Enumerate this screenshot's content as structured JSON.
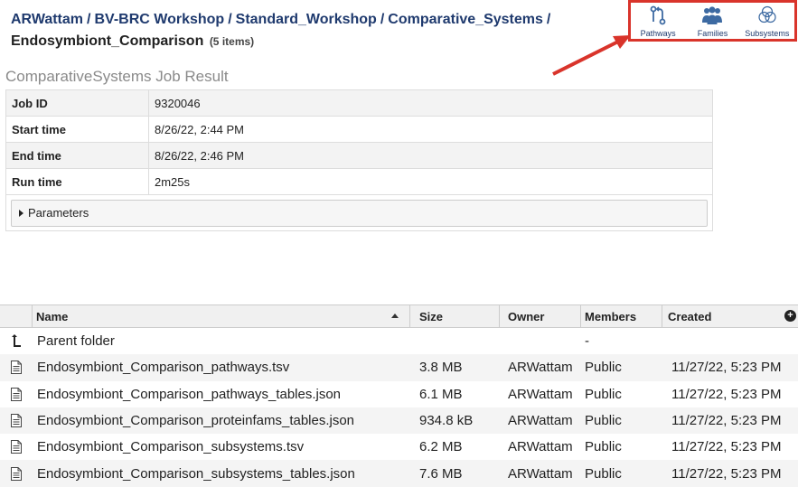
{
  "breadcrumb": {
    "crumbs": [
      "ARWattam",
      "BV-BRC Workshop",
      "Standard_Workshop",
      "Comparative_Systems"
    ],
    "separator": "/",
    "current": "Endosymbiont_Comparison",
    "count": "(5 items)"
  },
  "actions": [
    {
      "label": "Pathways",
      "icon": "pathways-icon"
    },
    {
      "label": "Families",
      "icon": "families-icon"
    },
    {
      "label": "Subsystems",
      "icon": "subsystems-icon"
    }
  ],
  "colors": {
    "highlight": "#d9342b",
    "link": "#1f3a6e",
    "icon": "#3d6aa2"
  },
  "job": {
    "title": "ComparativeSystems Job Result",
    "rows": [
      {
        "key": "Job ID",
        "value": "9320046"
      },
      {
        "key": "Start time",
        "value": "8/26/22, 2:44 PM"
      },
      {
        "key": "End time",
        "value": "8/26/22, 2:46 PM"
      },
      {
        "key": "Run time",
        "value": "2m25s"
      }
    ],
    "parameters_label": "Parameters"
  },
  "grid": {
    "headers": {
      "name": "Name",
      "size": "Size",
      "owner": "Owner",
      "members": "Members",
      "created": "Created"
    },
    "parent": {
      "name": "Parent folder",
      "members": "-"
    },
    "files": [
      {
        "name": "Endosymbiont_Comparison_pathways.tsv",
        "size": "3.8 MB",
        "owner": "ARWattam",
        "members": "Public",
        "created": "11/27/22, 5:23 PM"
      },
      {
        "name": "Endosymbiont_Comparison_pathways_tables.json",
        "size": "6.1 MB",
        "owner": "ARWattam",
        "members": "Public",
        "created": "11/27/22, 5:23 PM"
      },
      {
        "name": "Endosymbiont_Comparison_proteinfams_tables.json",
        "size": "934.8 kB",
        "owner": "ARWattam",
        "members": "Public",
        "created": "11/27/22, 5:23 PM"
      },
      {
        "name": "Endosymbiont_Comparison_subsystems.tsv",
        "size": "6.2 MB",
        "owner": "ARWattam",
        "members": "Public",
        "created": "11/27/22, 5:23 PM"
      },
      {
        "name": "Endosymbiont_Comparison_subsystems_tables.json",
        "size": "7.6 MB",
        "owner": "ARWattam",
        "members": "Public",
        "created": "11/27/22, 5:23 PM"
      }
    ]
  }
}
